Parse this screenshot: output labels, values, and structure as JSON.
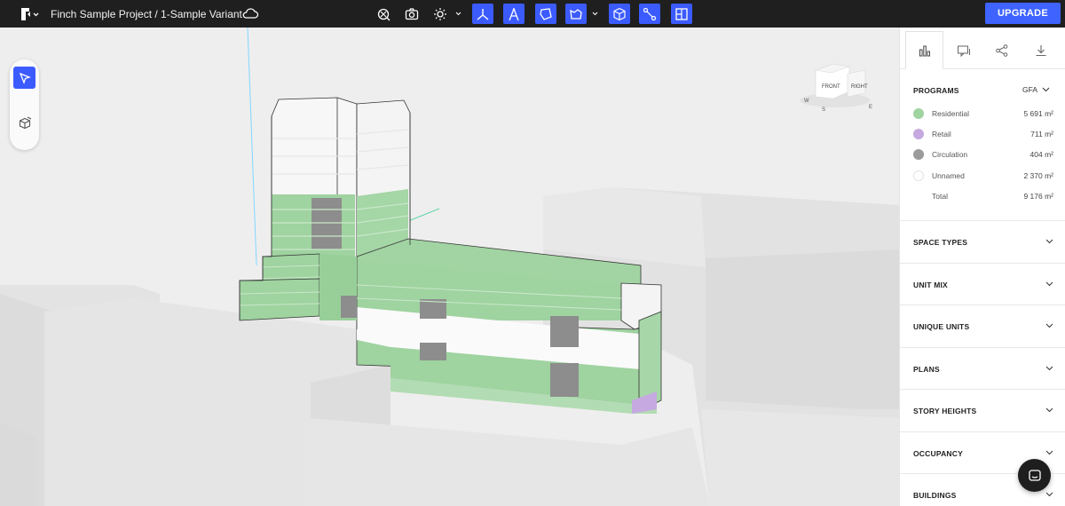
{
  "topbar": {
    "breadcrumb": "Finch Sample Project / 1-Sample Variant",
    "upgrade_label": "UPGRADE",
    "tools": [
      {
        "icon": "zoom-fit-icon",
        "active": false
      },
      {
        "icon": "camera-icon",
        "active": false
      },
      {
        "icon": "sun-icon",
        "active": false
      },
      {
        "icon": "axes-icon",
        "active": true
      },
      {
        "icon": "measure-icon",
        "active": true
      },
      {
        "icon": "boundary-icon",
        "active": true
      },
      {
        "icon": "site-shape-icon",
        "active": true
      },
      {
        "icon": "box-volume-icon",
        "active": true
      },
      {
        "icon": "connect-nodes-icon",
        "active": true
      },
      {
        "icon": "floorplan-icon",
        "active": true
      }
    ]
  },
  "viewcube": {
    "front": "FRONT",
    "right": "RIGHT",
    "w": "W",
    "s": "S",
    "e": "E"
  },
  "panel": {
    "programs_title": "PROGRAMS",
    "metric_select": "GFA",
    "programs": [
      {
        "name": "Residential",
        "value": "5 691 m²",
        "color": "#9fd3a0"
      },
      {
        "name": "Retail",
        "value": "711 m²",
        "color": "#c6a9e0"
      },
      {
        "name": "Circulation",
        "value": "404 m²",
        "color": "#9b9b9b"
      },
      {
        "name": "Unnamed",
        "value": "2 370 m²",
        "color": "#ffffff"
      },
      {
        "name": "Total",
        "value": "9 176 m²",
        "color": ""
      }
    ],
    "sections": [
      "SPACE TYPES",
      "UNIT MIX",
      "UNIQUE UNITS",
      "PLANS",
      "STORY HEIGHTS",
      "OCCUPANCY",
      "BUILDINGS"
    ]
  },
  "colors": {
    "accent": "#3b5bff",
    "topbar": "#1f1f1f",
    "residential": "#9fd3a0",
    "circulation": "#9b9b9b"
  }
}
